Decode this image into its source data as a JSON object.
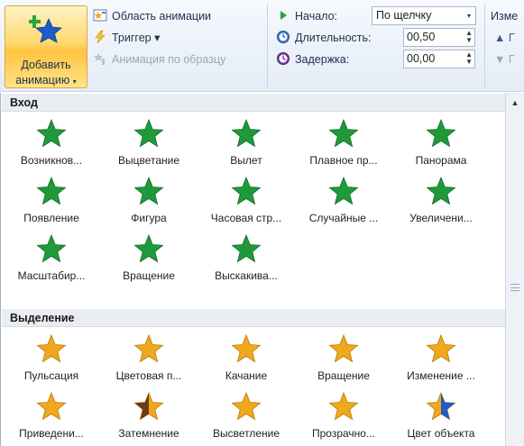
{
  "ribbon": {
    "add_animation": {
      "line1": "Добавить",
      "line2": "анимацию",
      "caret": "▾"
    },
    "animation_pane": "Область анимации",
    "trigger": "Триггер ▾",
    "painter": "Анимация по образцу",
    "start_label": "Начало:",
    "start_value": "По щелчку",
    "start_caret": "▾",
    "duration_label": "Длительность:",
    "duration_value": "00,50",
    "delay_label": "Задержка:",
    "delay_value": "00,00",
    "reorder_label": "Изме",
    "move_earlier": "▲ Г",
    "move_later": "▼ Г",
    "spin_glyph": "▲\n▼"
  },
  "gallery": {
    "entrance_header": "Вход",
    "entrance": [
      "Возникнов...",
      "Выцветание",
      "Вылет",
      "Плавное пр...",
      "Панорама",
      "Появление",
      "Фигура",
      "Часовая стр...",
      "Случайные ...",
      "Увеличени...",
      "Масштабир...",
      "Вращение",
      "Выскакива..."
    ],
    "emphasis_header": "Выделение",
    "emphasis": [
      "Пульсация",
      "Цветовая п...",
      "Качание",
      "Вращение",
      "Изменение ...",
      "Приведени...",
      "Затемнение",
      "Высветление",
      "Прозрачно...",
      "Цвет объекта"
    ]
  },
  "scroll": {
    "up": "▲"
  },
  "colors": {
    "entrance_green": "#1f9a3a",
    "emphasis_gold": "#f0a81c",
    "accent_blue": "#1e5cc8"
  },
  "icons": {
    "add_animation": "green-blue-star-plus-icon",
    "animation_pane": "animation-pane-icon",
    "trigger": "lightning-icon",
    "painter": "animation-painter-icon",
    "start": "play-triangle-icon",
    "duration": "clock-icon",
    "delay": "delay-clock-icon"
  }
}
